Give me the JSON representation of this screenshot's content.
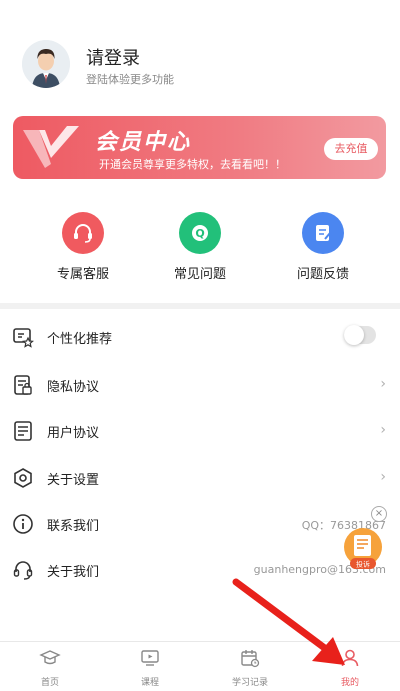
{
  "profile": {
    "title": "请登录",
    "subtitle": "登陆体验更多功能"
  },
  "vip": {
    "title": "会员中心",
    "subtitle": "开通会员尊享更多特权，去看看吧！！",
    "button": "去充值"
  },
  "quick_actions": [
    {
      "label": "专属客服",
      "icon": "headset-icon",
      "color": "#f05a5f"
    },
    {
      "label": "常见问题",
      "icon": "question-bubble-icon",
      "color": "#22c07a"
    },
    {
      "label": "问题反馈",
      "icon": "feedback-doc-icon",
      "color": "#4b86f0"
    }
  ],
  "settings": [
    {
      "label": "个性化推荐",
      "icon": "personalize-icon",
      "control": "toggle",
      "toggle_on": false
    },
    {
      "label": "隐私协议",
      "icon": "privacy-doc-icon",
      "control": "chevron"
    },
    {
      "label": "用户协议",
      "icon": "user-agreement-icon",
      "control": "chevron"
    },
    {
      "label": "关于设置",
      "icon": "settings-hexagon-icon",
      "control": "chevron"
    },
    {
      "label": "联系我们",
      "icon": "info-icon",
      "control": "value",
      "value": "QQ：76381867"
    },
    {
      "label": "关于我们",
      "icon": "headset-outline-icon",
      "control": "value",
      "value": "guanhengpro@163.com"
    }
  ],
  "floating_widget": {
    "label": "投诉"
  },
  "chevron": "›",
  "close_glyph": "×",
  "tabbar": [
    {
      "label": "首页",
      "icon": "home-graduation-icon"
    },
    {
      "label": "课程",
      "icon": "course-monitor-icon"
    },
    {
      "label": "学习记录",
      "icon": "calendar-record-icon"
    },
    {
      "label": "我的",
      "icon": "person-icon",
      "active": true
    }
  ],
  "colors": {
    "accent": "#e85b62",
    "vip_start": "#ee5a62",
    "vip_end": "#f29aa0"
  }
}
